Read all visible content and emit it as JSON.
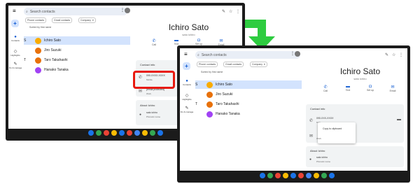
{
  "shared": {
    "search_placeholder": "Search contacts",
    "filters": [
      "Phone contacts",
      "Gmail contacts",
      "Company"
    ],
    "sort_label": "Sorted by first name",
    "sidebar": [
      "Contacts",
      "Highlights",
      "Fix & manage"
    ],
    "contacts": [
      {
        "letter": "S",
        "name": "Ichiro Sato",
        "color": "#f9ab00"
      },
      {
        "letter": "",
        "name": "Jiro Suzuki",
        "color": "#e8710a"
      },
      {
        "letter": "T",
        "name": "Taro Takahashi",
        "color": "#e8710a"
      },
      {
        "letter": "",
        "name": "Hanako Tanaka",
        "color": "#a142f4"
      }
    ],
    "actions": [
      "Call",
      "Text",
      "Set up",
      "Email"
    ],
    "dock_colors": [
      "#1a73e8",
      "#34a853",
      "#ea4335",
      "#fbbc04",
      "#1a73e8",
      "#ea4335",
      "#4285f4",
      "#fbbc04",
      "#34a853",
      "#1a73e8"
    ]
  },
  "left": {
    "contact_name": "Ichiro Sato",
    "phonetic": "sato ichiro",
    "contact_info_title": "Contact info",
    "phone": "090-XXXX-XXXX",
    "phone_label": "Mobile",
    "email": "[email protected]",
    "email_label": "Work",
    "about_title": "About Ichiro",
    "about_value": "sato ichiro",
    "about_label": "Phonetic name"
  },
  "right": {
    "contact_name": "Ichiro Sato",
    "phonetic": "sato ichiro",
    "contact_info_title": "Contact info",
    "phone": "090-XXX-XXXX",
    "phone_label": "Mob",
    "email": "[email protected]",
    "email_label": "Work",
    "copy_popup": "Copy to clipboard",
    "about_title": "About Ichiro",
    "about_value": "sato ichiro",
    "about_label": "Phonetic name"
  },
  "colors": {
    "highlight": "#e8190e",
    "arrow": "#2ecc40",
    "accent": "#0b57d0"
  }
}
